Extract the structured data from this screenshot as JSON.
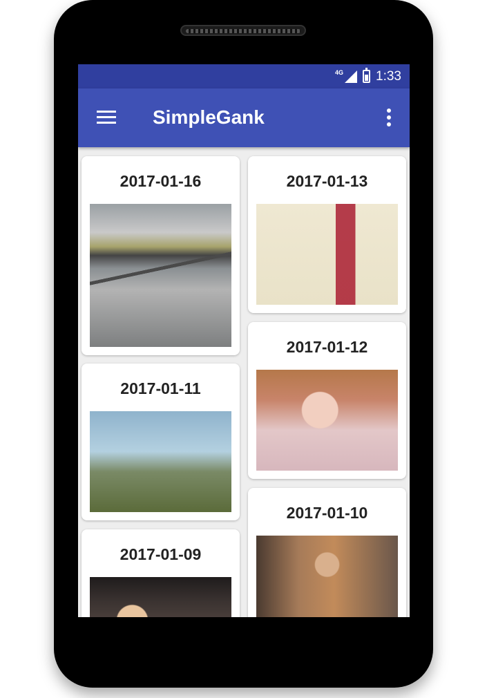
{
  "status_bar": {
    "network": "4G",
    "time": "1:33"
  },
  "app_bar": {
    "title": "SimpleGank",
    "menu_icon": "hamburger-icon",
    "overflow_icon": "more-vert-icon"
  },
  "colors": {
    "status_bar": "#303f9f",
    "app_bar": "#3f51b5",
    "background": "#eeeeee",
    "card": "#ffffff"
  },
  "feed": [
    {
      "date": "2017-01-16"
    },
    {
      "date": "2017-01-13"
    },
    {
      "date": "2017-01-12"
    },
    {
      "date": "2017-01-11"
    },
    {
      "date": "2017-01-10"
    },
    {
      "date": "2017-01-09"
    }
  ]
}
